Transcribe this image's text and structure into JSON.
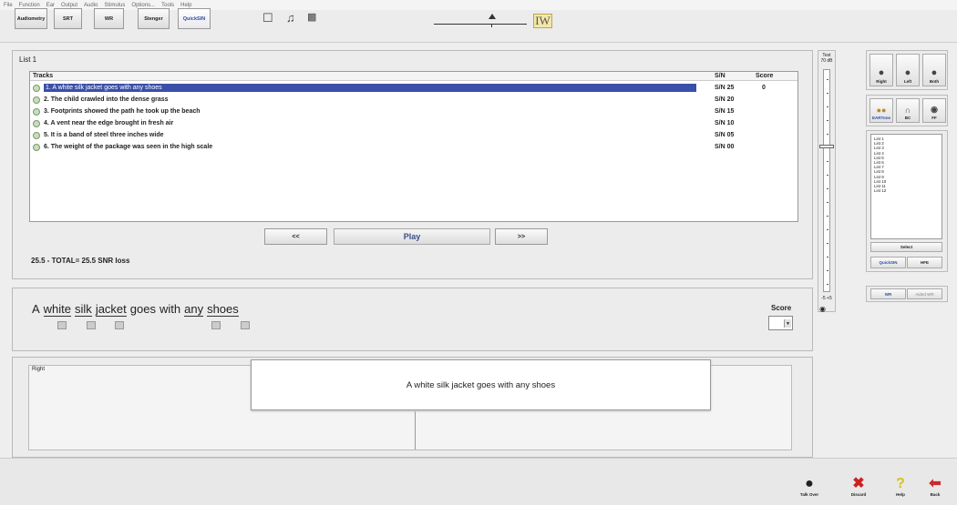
{
  "menu": [
    "File",
    "Function",
    "Ear",
    "Output",
    "Audio",
    "Stimulus",
    "Options...",
    "Tools",
    "Help"
  ],
  "toolbar": {
    "buttons": [
      "Audiometry",
      "SRT",
      "WR",
      "Stenger",
      "QuickSIN"
    ],
    "icons": [
      "edit-icon",
      "headphones-icon",
      "video-icon"
    ],
    "logo": "IW"
  },
  "list": {
    "title": "List 1",
    "headers": {
      "tracks": "Tracks",
      "sn": "S/N",
      "score": "Score"
    },
    "rows": [
      {
        "text": "1. A white silk jacket goes with any shoes",
        "sn": "S/N 25",
        "score": "0"
      },
      {
        "text": "2. The child crawled into the dense grass",
        "sn": "S/N 20",
        "score": ""
      },
      {
        "text": "3. Footprints showed the path he took up the beach",
        "sn": "S/N 15",
        "score": ""
      },
      {
        "text": "4. A vent near the edge brought in fresh air",
        "sn": "S/N 10",
        "score": ""
      },
      {
        "text": "5. It is a band of steel three inches wide",
        "sn": "S/N 05",
        "score": ""
      },
      {
        "text": "6. The weight of the package was seen in the high scale",
        "sn": "S/N 00",
        "score": ""
      }
    ],
    "prev": "<<",
    "play": "Play",
    "next": ">>",
    "summary": "25.5 - TOTAL= 25.5 SNR loss"
  },
  "sentence": {
    "words": [
      {
        "w": "A",
        "key": false
      },
      {
        "w": "white",
        "key": true
      },
      {
        "w": "silk",
        "key": true
      },
      {
        "w": "jacket",
        "key": true
      },
      {
        "w": "goes",
        "key": false
      },
      {
        "w": "with",
        "key": false
      },
      {
        "w": "any",
        "key": true
      },
      {
        "w": "shoes",
        "key": true
      }
    ],
    "score_label": "Score"
  },
  "bottom": {
    "right_label": "Right",
    "popup_text": "A white silk jacket goes with any shoes"
  },
  "test_level": {
    "label_line1": "Test",
    "label_line2": "70 dB",
    "bottom": "-5 +5"
  },
  "right_panel": {
    "ear_buttons": [
      "Right",
      "Left",
      "Both"
    ],
    "transducers": [
      "EARTone",
      "BC",
      "FF"
    ],
    "lists": [
      "List 1",
      "List 2",
      "List 3",
      "List 4",
      "List 5",
      "List 6",
      "List 7",
      "List 8",
      "List 9",
      "List 10",
      "List 11",
      "List 12"
    ],
    "select": "Select",
    "modes": [
      "QuickSIN",
      "HFE"
    ],
    "wr_modes": [
      "WR",
      "Aided WR"
    ]
  },
  "bottom_bar": [
    "Talk Over",
    "Discard",
    "Help",
    "Back"
  ],
  "colors": {
    "selection": "#3a4fa8",
    "accent_text": "#2a4ea8",
    "discard": "#cc2222",
    "help": "#d4c21f",
    "back": "#cc2a2a"
  }
}
